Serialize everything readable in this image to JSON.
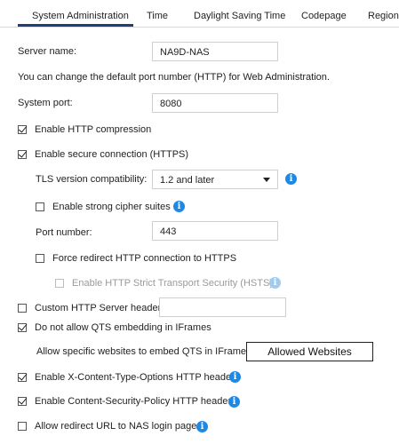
{
  "tabs": [
    {
      "label": "System Administration",
      "active": true
    },
    {
      "label": "Time",
      "active": false
    },
    {
      "label": "Daylight Saving Time",
      "active": false
    },
    {
      "label": "Codepage",
      "active": false
    },
    {
      "label": "Region",
      "active": false
    }
  ],
  "server_name": {
    "label": "Server name:",
    "value": "NA9D-NAS"
  },
  "port_note": "You can change the default port number (HTTP) for Web Administration.",
  "system_port": {
    "label": "System port:",
    "value": "8080"
  },
  "http_compression": {
    "label": "Enable HTTP compression",
    "checked": true
  },
  "secure_connection": {
    "label": "Enable secure connection (HTTPS)",
    "checked": true
  },
  "tls": {
    "label": "TLS version compatibility:",
    "value": "1.2 and later"
  },
  "strong_ciphers": {
    "label": "Enable strong cipher suites",
    "checked": false
  },
  "port_number": {
    "label": "Port number:",
    "value": "443"
  },
  "force_redirect": {
    "label": "Force redirect HTTP connection to HTTPS",
    "checked": false
  },
  "hsts": {
    "label": "Enable HTTP Strict Transport Security (HSTS)",
    "checked": false,
    "disabled": true
  },
  "custom_header": {
    "label": "Custom HTTP Server header:",
    "checked": false,
    "value": ""
  },
  "no_iframe": {
    "label": "Do not allow QTS embedding in IFrames",
    "checked": true
  },
  "allow_sites": {
    "label": "Allow specific websites to embed QTS in IFrames",
    "button": "Allowed Websites"
  },
  "x_content_type": {
    "label": "Enable X-Content-Type-Options HTTP header",
    "checked": true
  },
  "csp": {
    "label": "Enable Content-Security-Policy HTTP header",
    "checked": true
  },
  "redirect_url": {
    "label": "Allow redirect URL to NAS login page",
    "checked": false
  },
  "colors": {
    "accent": "#1e3f7a",
    "info": "#1e88e5"
  }
}
